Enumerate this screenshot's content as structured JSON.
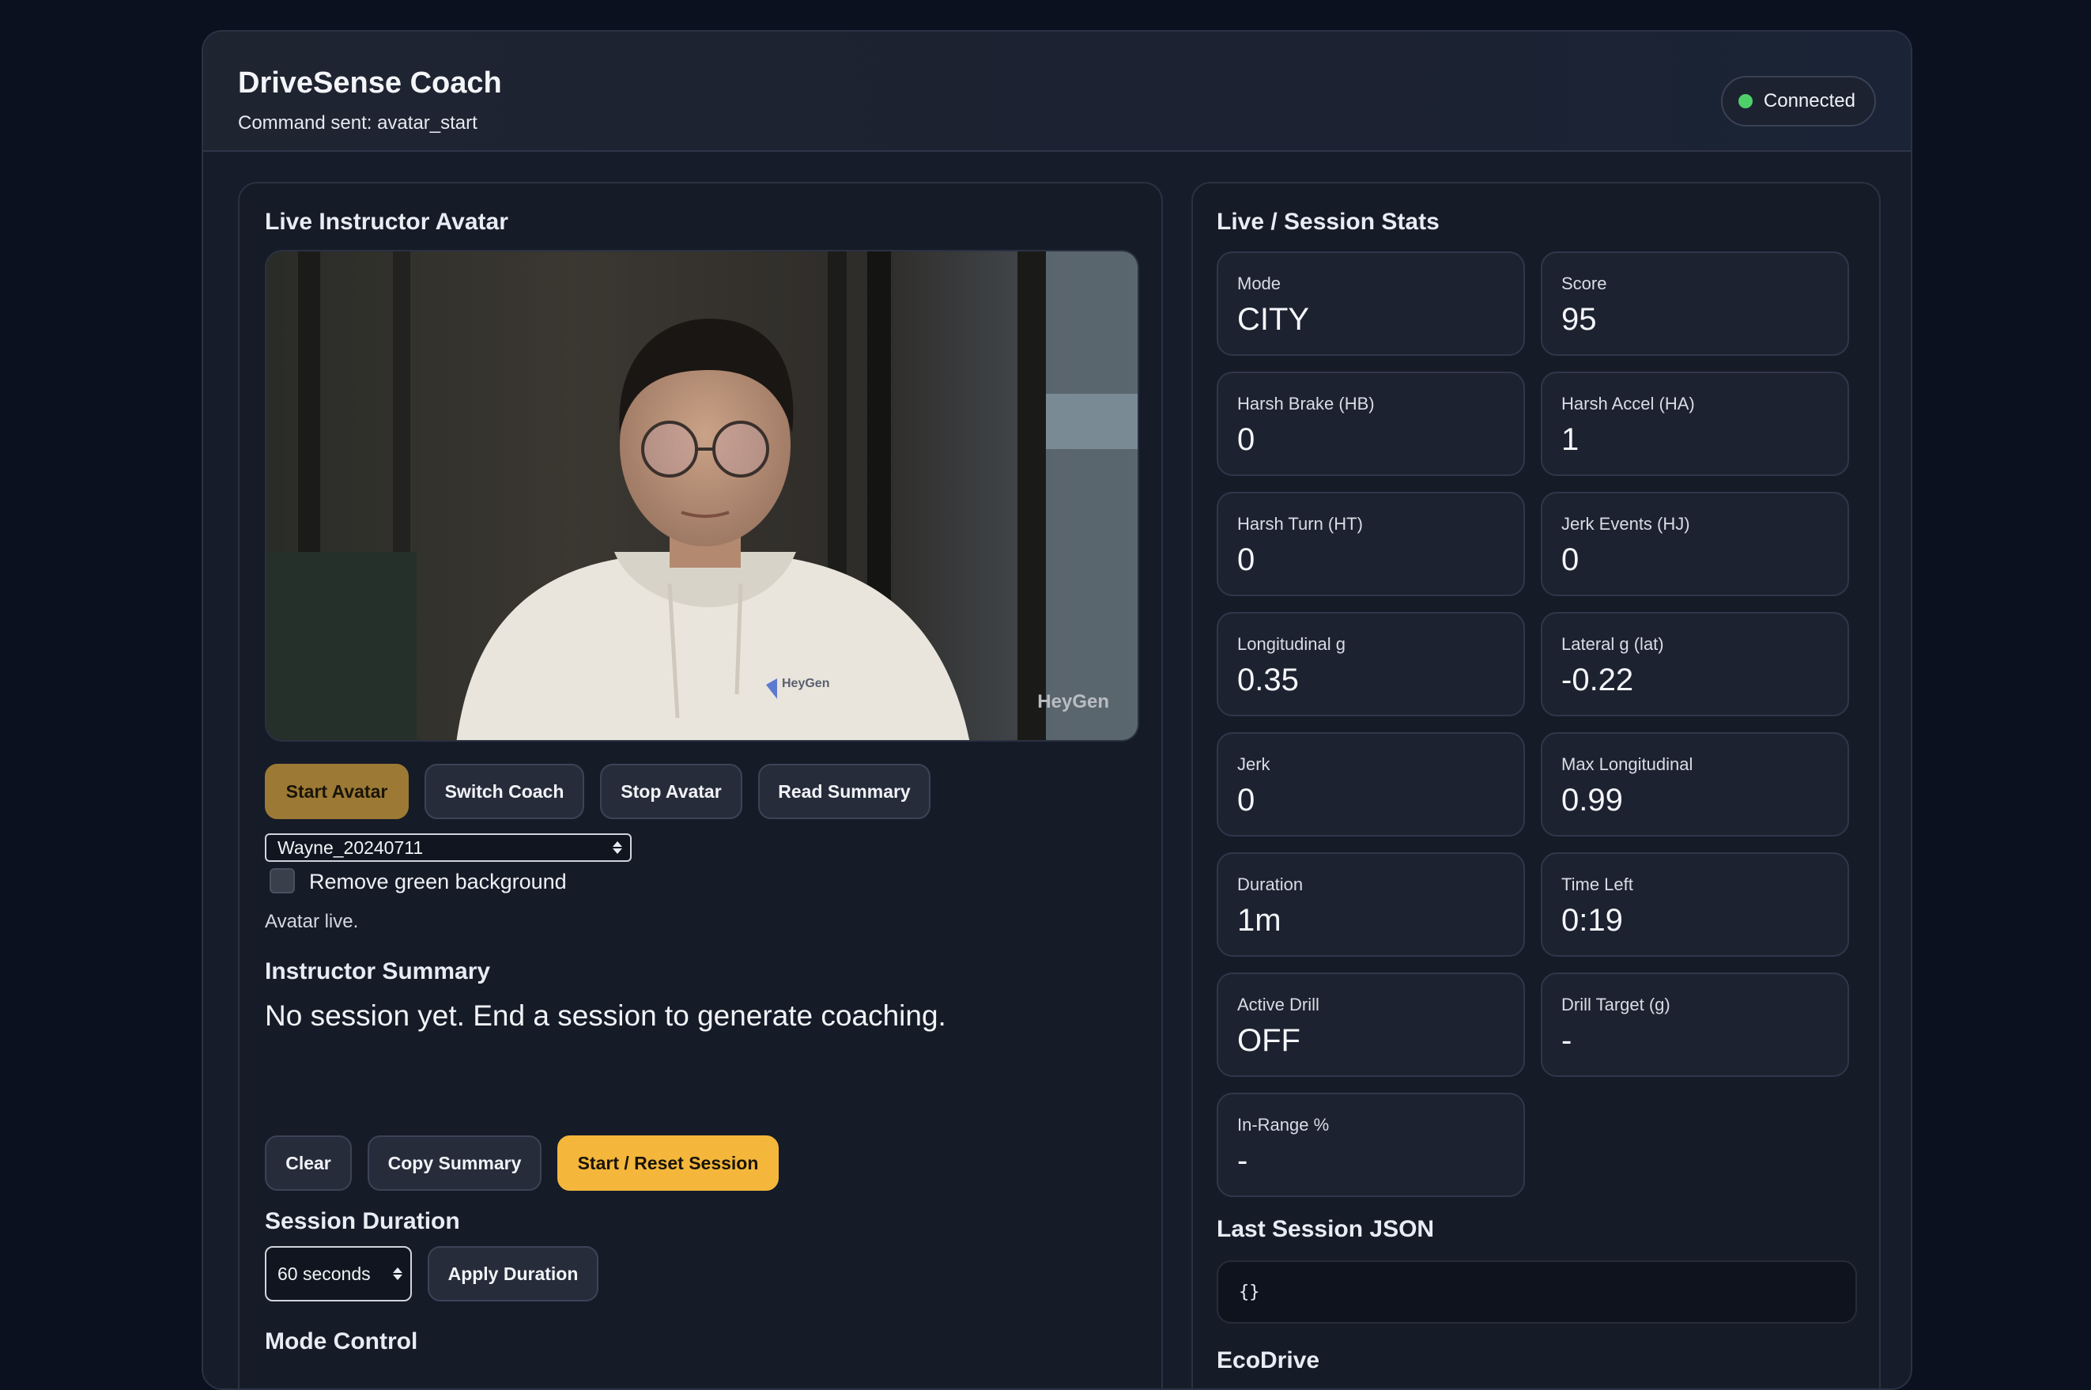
{
  "header": {
    "title": "DriveSense Coach",
    "subtitle": "Command sent: avatar_start",
    "status": "Connected"
  },
  "avatar_panel": {
    "title": "Live Instructor Avatar",
    "watermark": "HeyGen",
    "hoodie_logo": "HeyGen",
    "buttons": {
      "start": "Start Avatar",
      "switch": "Switch Coach",
      "stop": "Stop Avatar",
      "read": "Read Summary"
    },
    "avatar_select": "Wayne_20240711",
    "remove_green_label": "Remove green background",
    "remove_green_checked": false,
    "status_text": "Avatar live.",
    "summary_title": "Instructor Summary",
    "summary_text": "No session yet. End a session to generate coaching.",
    "summary_buttons": {
      "clear": "Clear",
      "copy": "Copy Summary",
      "reset": "Start / Reset Session"
    },
    "duration_title": "Session Duration",
    "duration_select": "60 seconds",
    "apply_duration": "Apply Duration",
    "mode_title": "Mode Control"
  },
  "stats_panel": {
    "title": "Live / Session Stats",
    "cards": [
      {
        "label": "Mode",
        "value": "CITY"
      },
      {
        "label": "Score",
        "value": "95"
      },
      {
        "label": "Harsh Brake (HB)",
        "value": "0"
      },
      {
        "label": "Harsh Accel (HA)",
        "value": "1"
      },
      {
        "label": "Harsh Turn (HT)",
        "value": "0"
      },
      {
        "label": "Jerk Events (HJ)",
        "value": "0"
      },
      {
        "label": "Longitudinal g",
        "value": "0.35"
      },
      {
        "label": "Lateral g (lat)",
        "value": "-0.22"
      },
      {
        "label": "Jerk",
        "value": "0"
      },
      {
        "label": "Max Longitudinal",
        "value": "0.99"
      },
      {
        "label": "Duration",
        "value": "1m"
      },
      {
        "label": "Time Left",
        "value": "0:19"
      },
      {
        "label": "Active Drill",
        "value": "OFF"
      },
      {
        "label": "Drill Target (g)",
        "value": "-"
      },
      {
        "label": "In-Range %",
        "value": "-"
      }
    ],
    "json_title": "Last Session JSON",
    "json_value": "{}",
    "next_section": "EcoDrive"
  },
  "colors": {
    "accent_gold": "#9c7a35",
    "accent_yellow": "#f4b73c",
    "status_green": "#4fcf6a"
  }
}
